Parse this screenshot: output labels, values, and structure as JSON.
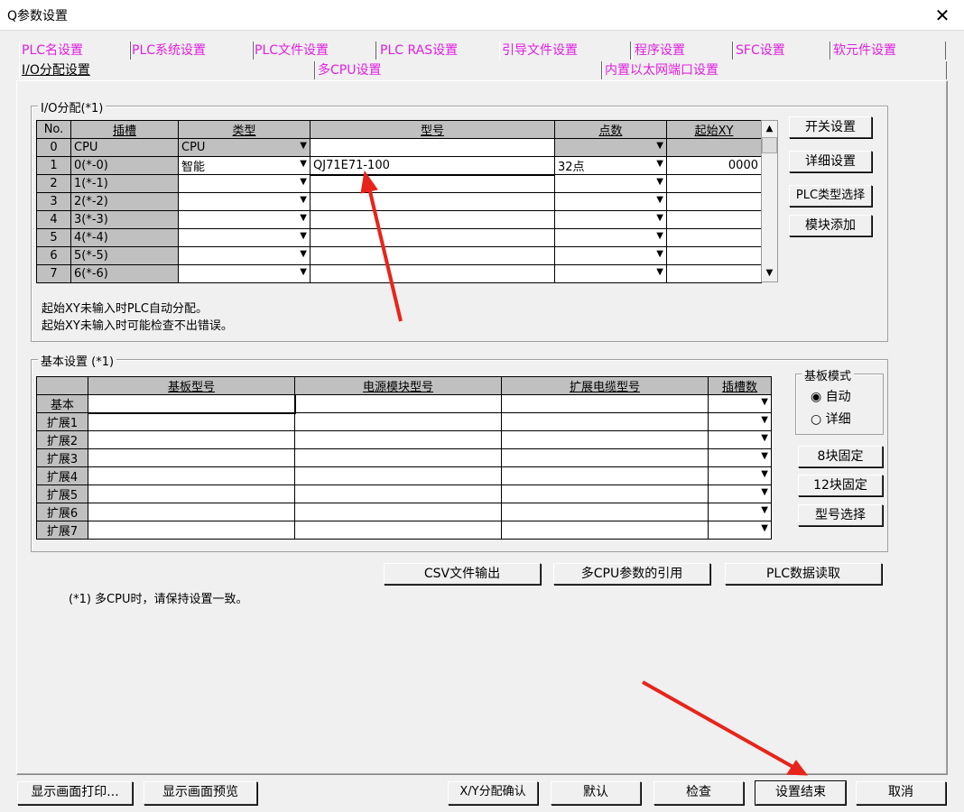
{
  "window": {
    "title": "Q参数设置",
    "close_glyph": "✕"
  },
  "tabs_row1": [
    "PLC名设置",
    "PLC系统设置",
    "PLC文件设置",
    "PLC RAS设置",
    "引导文件设置",
    "程序设置",
    "SFC设置",
    "软元件设置"
  ],
  "tabs_row2": [
    "I/O分配设置",
    "多CPU设置",
    "内置以太网端口设置"
  ],
  "io": {
    "legend": "I/O分配(*1)",
    "headers": [
      "No.",
      "插槽",
      "类型",
      "型号",
      "点数",
      "起始XY"
    ],
    "rows": [
      {
        "no": "0",
        "slot": "CPU",
        "type": "CPU",
        "model": "",
        "points": "",
        "xy": ""
      },
      {
        "no": "1",
        "slot": "0(*-0)",
        "type": "智能",
        "model": "QJ71E71-100",
        "points": "32点",
        "xy": "0000"
      },
      {
        "no": "2",
        "slot": "1(*-1)",
        "type": "",
        "model": "",
        "points": "",
        "xy": ""
      },
      {
        "no": "3",
        "slot": "2(*-2)",
        "type": "",
        "model": "",
        "points": "",
        "xy": ""
      },
      {
        "no": "4",
        "slot": "3(*-3)",
        "type": "",
        "model": "",
        "points": "",
        "xy": ""
      },
      {
        "no": "5",
        "slot": "4(*-4)",
        "type": "",
        "model": "",
        "points": "",
        "xy": ""
      },
      {
        "no": "6",
        "slot": "5(*-5)",
        "type": "",
        "model": "",
        "points": "",
        "xy": ""
      },
      {
        "no": "7",
        "slot": "6(*-6)",
        "type": "",
        "model": "",
        "points": "",
        "xy": ""
      }
    ],
    "note1": "起始XY未输入时PLC自动分配。",
    "note2": "起始XY未输入时可能检查不出错误。",
    "buttons": [
      "开关设置",
      "详细设置",
      "PLC类型选择",
      "模块添加"
    ]
  },
  "basic": {
    "legend": "基本设置 (*1)",
    "headers": [
      "基板型号",
      "电源模块型号",
      "扩展电缆型号",
      "插槽数"
    ],
    "rows": [
      "基本",
      "扩展1",
      "扩展2",
      "扩展3",
      "扩展4",
      "扩展5",
      "扩展6",
      "扩展7"
    ],
    "mode_legend": "基板模式",
    "mode_auto": "自动",
    "mode_detail": "详细",
    "buttons": [
      "8块固定",
      "12块固定",
      "型号选择"
    ]
  },
  "mid_buttons": [
    "CSV文件输出",
    "多CPU参数的引用",
    "PLC数据读取"
  ],
  "footnote": "(*1) 多CPU时，请保持设置一致。",
  "bottom_buttons": {
    "print": "显示画面打印...",
    "preview": "显示画面预览",
    "xy_check": "X/Y分配确认",
    "default": "默认",
    "check": "检查",
    "finish": "设置结束",
    "cancel": "取消"
  }
}
